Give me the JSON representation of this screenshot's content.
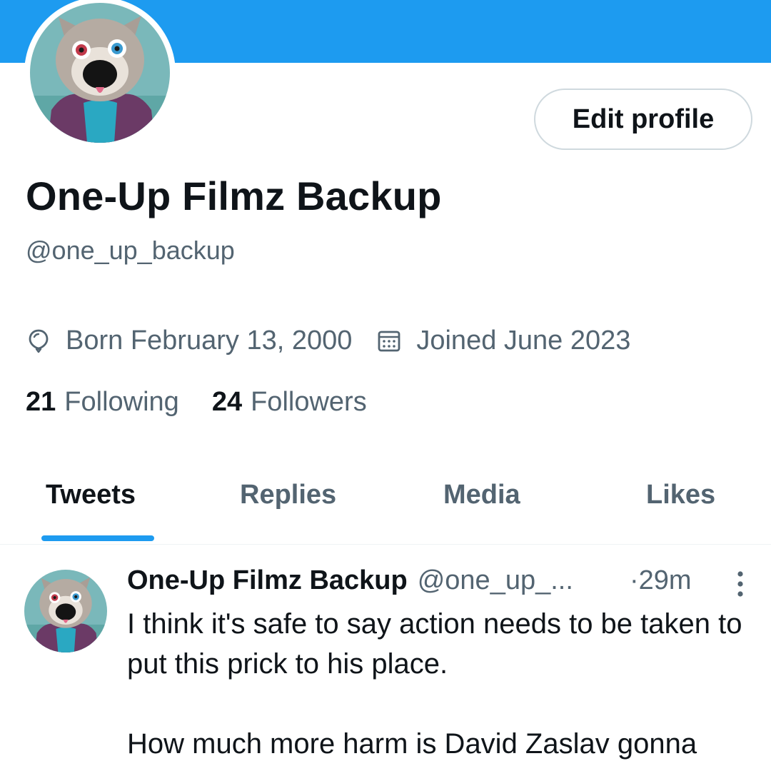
{
  "colors": {
    "accent": "#1d9bf0",
    "text_primary": "#0f1419",
    "text_secondary": "#536471",
    "border": "#cfd9de"
  },
  "profile": {
    "display_name": "One-Up Filmz Backup",
    "handle": "@one_up_backup",
    "edit_button_label": "Edit profile",
    "avatar_icon": "avatar-plush-wolf",
    "birth": {
      "icon": "balloon-icon",
      "text": "Born February 13, 2000"
    },
    "joined": {
      "icon": "calendar-icon",
      "text": "Joined June 2023"
    },
    "following_count": "21",
    "following_label": "Following",
    "followers_count": "24",
    "followers_label": "Followers"
  },
  "tabs": [
    {
      "label": "Tweets",
      "active": true
    },
    {
      "label": "Replies",
      "active": false
    },
    {
      "label": "Media",
      "active": false
    },
    {
      "label": "Likes",
      "active": false
    }
  ],
  "tweet": {
    "author_name": "One-Up Filmz Backup",
    "author_handle": "@one_up_...",
    "time": "·29m",
    "more_icon": "more-vertical-icon",
    "paragraphs": [
      "I think it's safe to say action needs to be taken to put this prick to his place.",
      "How much more harm is David Zaslav gonna"
    ]
  }
}
